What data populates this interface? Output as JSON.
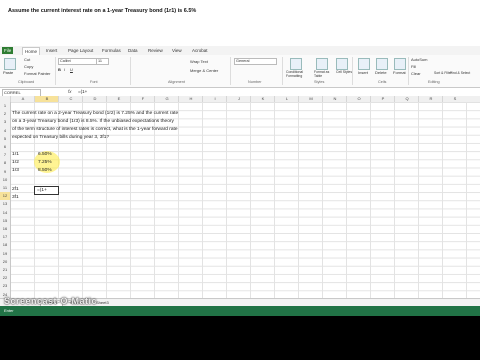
{
  "question": {
    "title": "Assume the current interest rate on a 1-year Treasury bond (1r1) is 6.5%",
    "lines": [
      "The current rate on a 2-year Treasury bond (1r2) is 7.25% and the current rate",
      "on a 3-year Treasury bond (1r3) is 8.5%. If the unbiased expectations theory",
      "of the term structure of interest rates is correct, what is the 1-year forward rate",
      "expected on Treasury bills during year 3, 3f1?"
    ]
  },
  "ribbon": {
    "tabs": [
      "File",
      "Home",
      "Insert",
      "Page Layout",
      "Formulas",
      "Data",
      "Review",
      "View",
      "Acrobat"
    ],
    "clipboard": {
      "cut": "Cut",
      "copy": "Copy",
      "format_painter": "Format Painter",
      "paste": "Paste",
      "group": "Clipboard"
    },
    "font": {
      "name": "Calibri",
      "size": "11",
      "group": "Font"
    },
    "alignment": {
      "wrap": "Wrap Text",
      "merge": "Merge & Center",
      "group": "Alignment"
    },
    "number": {
      "format": "General",
      "group": "Number"
    },
    "styles": {
      "conditional": "Conditional Formatting",
      "table": "Format as Table",
      "cell": "Cell Styles",
      "group": "Styles"
    },
    "cells": {
      "insert": "Insert",
      "delete": "Delete",
      "format": "Format",
      "group": "Cells"
    },
    "editing": {
      "autosum": "AutoSum",
      "fill": "Fill",
      "clear": "Clear",
      "sort": "Sort & Filter",
      "find": "Find & Select",
      "group": "Editing"
    }
  },
  "formula_bar": {
    "name_box": "CORREL",
    "fx": "fx",
    "formula": "=(1+"
  },
  "columns": [
    "A",
    "B",
    "C",
    "D",
    "E",
    "F",
    "G",
    "H",
    "I",
    "J",
    "K",
    "L",
    "M",
    "N",
    "O",
    "P",
    "Q",
    "R",
    "S"
  ],
  "rows": [
    "1",
    "2",
    "3",
    "4",
    "5",
    "6",
    "7",
    "8",
    "9",
    "10",
    "11",
    "12",
    "13",
    "14",
    "15",
    "16",
    "17",
    "18",
    "19",
    "20",
    "21",
    "22",
    "23",
    "24"
  ],
  "cells": {
    "r7_a": "1r1",
    "r7_b": "6.50%",
    "r8_a": "1r2",
    "r8_b": "7.25%",
    "r9_a": "1r3",
    "r9_b": "8.50%",
    "r12_a": "2f1",
    "r12_b": "=(1+",
    "r13_a": "3f1"
  },
  "sheets": [
    "Sheet1",
    "Sheet2",
    "Sheet3"
  ],
  "status": "Enter",
  "watermark": "Screencast-O-Matic"
}
